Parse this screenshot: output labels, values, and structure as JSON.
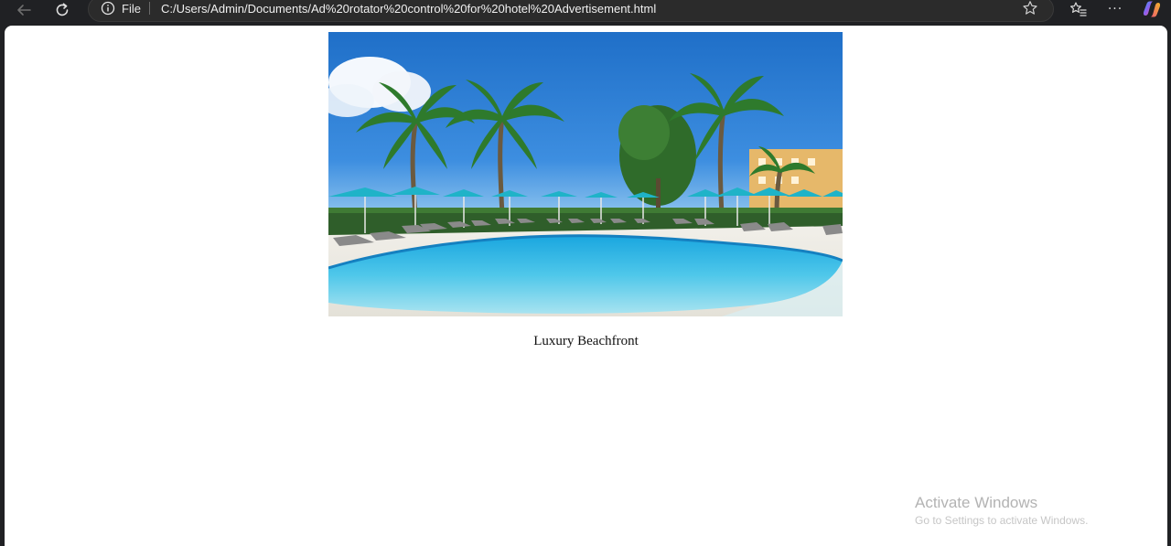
{
  "browser": {
    "back_icon": "back-arrow-icon",
    "refresh_icon": "refresh-icon",
    "address": {
      "info_icon": "info-icon",
      "scheme_label": "File",
      "url": "C:/Users/Admin/Documents/Ad%20rotator%20control%20for%20hotel%20Advertisement.html",
      "favorite_icon": "star-icon"
    },
    "toolbar": {
      "favorites_icon": "favorites-list-icon",
      "more_label": "···",
      "copilot_icon": "copilot-icon"
    }
  },
  "page": {
    "ad": {
      "image_subject": "hotel pool with palm trees and turquoise umbrellas",
      "caption": "Luxury Beachfront"
    }
  },
  "os": {
    "watermark_title": "Activate Windows",
    "watermark_subtitle": "Go to Settings to activate Windows."
  },
  "colors": {
    "chrome_bg": "#202124",
    "page_bg": "#ffffff",
    "sky": "#2f7fd0",
    "water": "#47c4e6",
    "umbrella": "#1fb3c8"
  }
}
